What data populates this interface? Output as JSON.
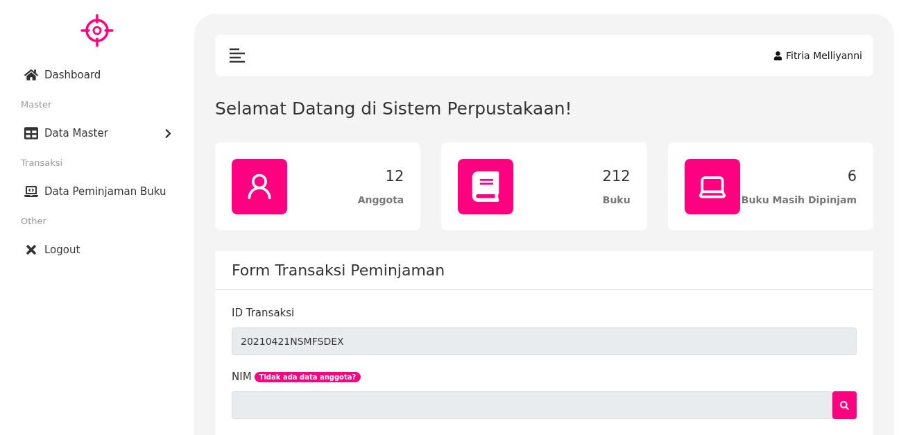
{
  "sidebar": {
    "items": [
      {
        "kind": "link",
        "label": "Dashboard"
      },
      {
        "kind": "heading",
        "label": "Master"
      },
      {
        "kind": "dropdown",
        "label": "Data Master",
        "expanded": false
      },
      {
        "kind": "heading",
        "label": "Transaksi"
      },
      {
        "kind": "link",
        "label": "Data Peminjaman Buku"
      },
      {
        "kind": "heading",
        "label": "Other"
      },
      {
        "kind": "link",
        "label": "Logout"
      }
    ]
  },
  "topbar": {
    "user": "Fitria Melliyanni"
  },
  "heading": "Selamat Datang di Sistem Perpustakaan!",
  "stats": [
    {
      "value": "12",
      "label": "Anggota"
    },
    {
      "value": "212",
      "label": "Buku"
    },
    {
      "value": "6",
      "label": "Buku Masih Dipinjam"
    }
  ],
  "form": {
    "title": "Form Transaksi Peminjaman",
    "fields": [
      {
        "label": "ID Transaksi",
        "value": "20210421NSMFSDEX",
        "search": false
      },
      {
        "label": "NIM",
        "badge": "Tidak ada data anggota?",
        "search": true
      }
    ]
  }
}
